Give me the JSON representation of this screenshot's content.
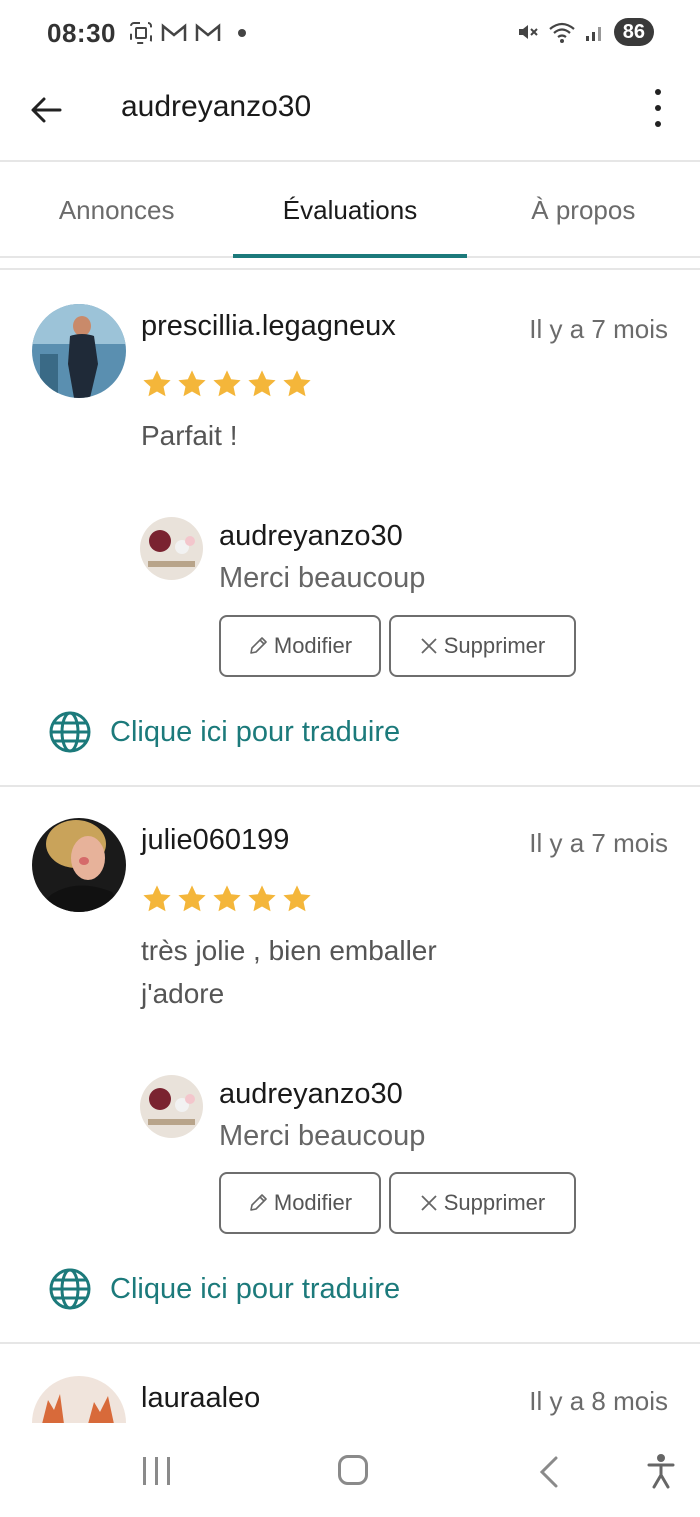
{
  "status_bar": {
    "time": "08:30",
    "battery": "86"
  },
  "app_bar": {
    "title": "audreyanzo30"
  },
  "tabs": [
    {
      "label": "Annonces",
      "active": false
    },
    {
      "label": "Évaluations",
      "active": true
    },
    {
      "label": "À propos",
      "active": false
    }
  ],
  "reviews": [
    {
      "reviewer": "prescillia.legagneux",
      "date": "Il y a 7 mois",
      "rating": 5,
      "text": "Parfait !",
      "reply": {
        "author": "audreyanzo30",
        "text": "Merci beaucoup",
        "edit_label": "Modifier",
        "delete_label": "Supprimer"
      },
      "translate_label": "Clique ici pour traduire"
    },
    {
      "reviewer": "julie060199",
      "date": "Il y a 7 mois",
      "rating": 5,
      "text": "très jolie , bien emballer j'adore",
      "reply": {
        "author": "audreyanzo30",
        "text": "Merci beaucoup",
        "edit_label": "Modifier",
        "delete_label": "Supprimer"
      },
      "translate_label": "Clique ici pour traduire"
    },
    {
      "reviewer": "lauraaleo",
      "date": "Il y a 8 mois"
    }
  ],
  "colors": {
    "accent": "#1c7a7b",
    "star": "#f4b63a",
    "divider": "#e6e6e6"
  },
  "icons": {
    "back": "arrow-left-icon",
    "more": "more-vertical-icon",
    "star": "star-icon",
    "edit": "pencil-icon",
    "delete": "close-icon",
    "translate": "globe-icon"
  }
}
